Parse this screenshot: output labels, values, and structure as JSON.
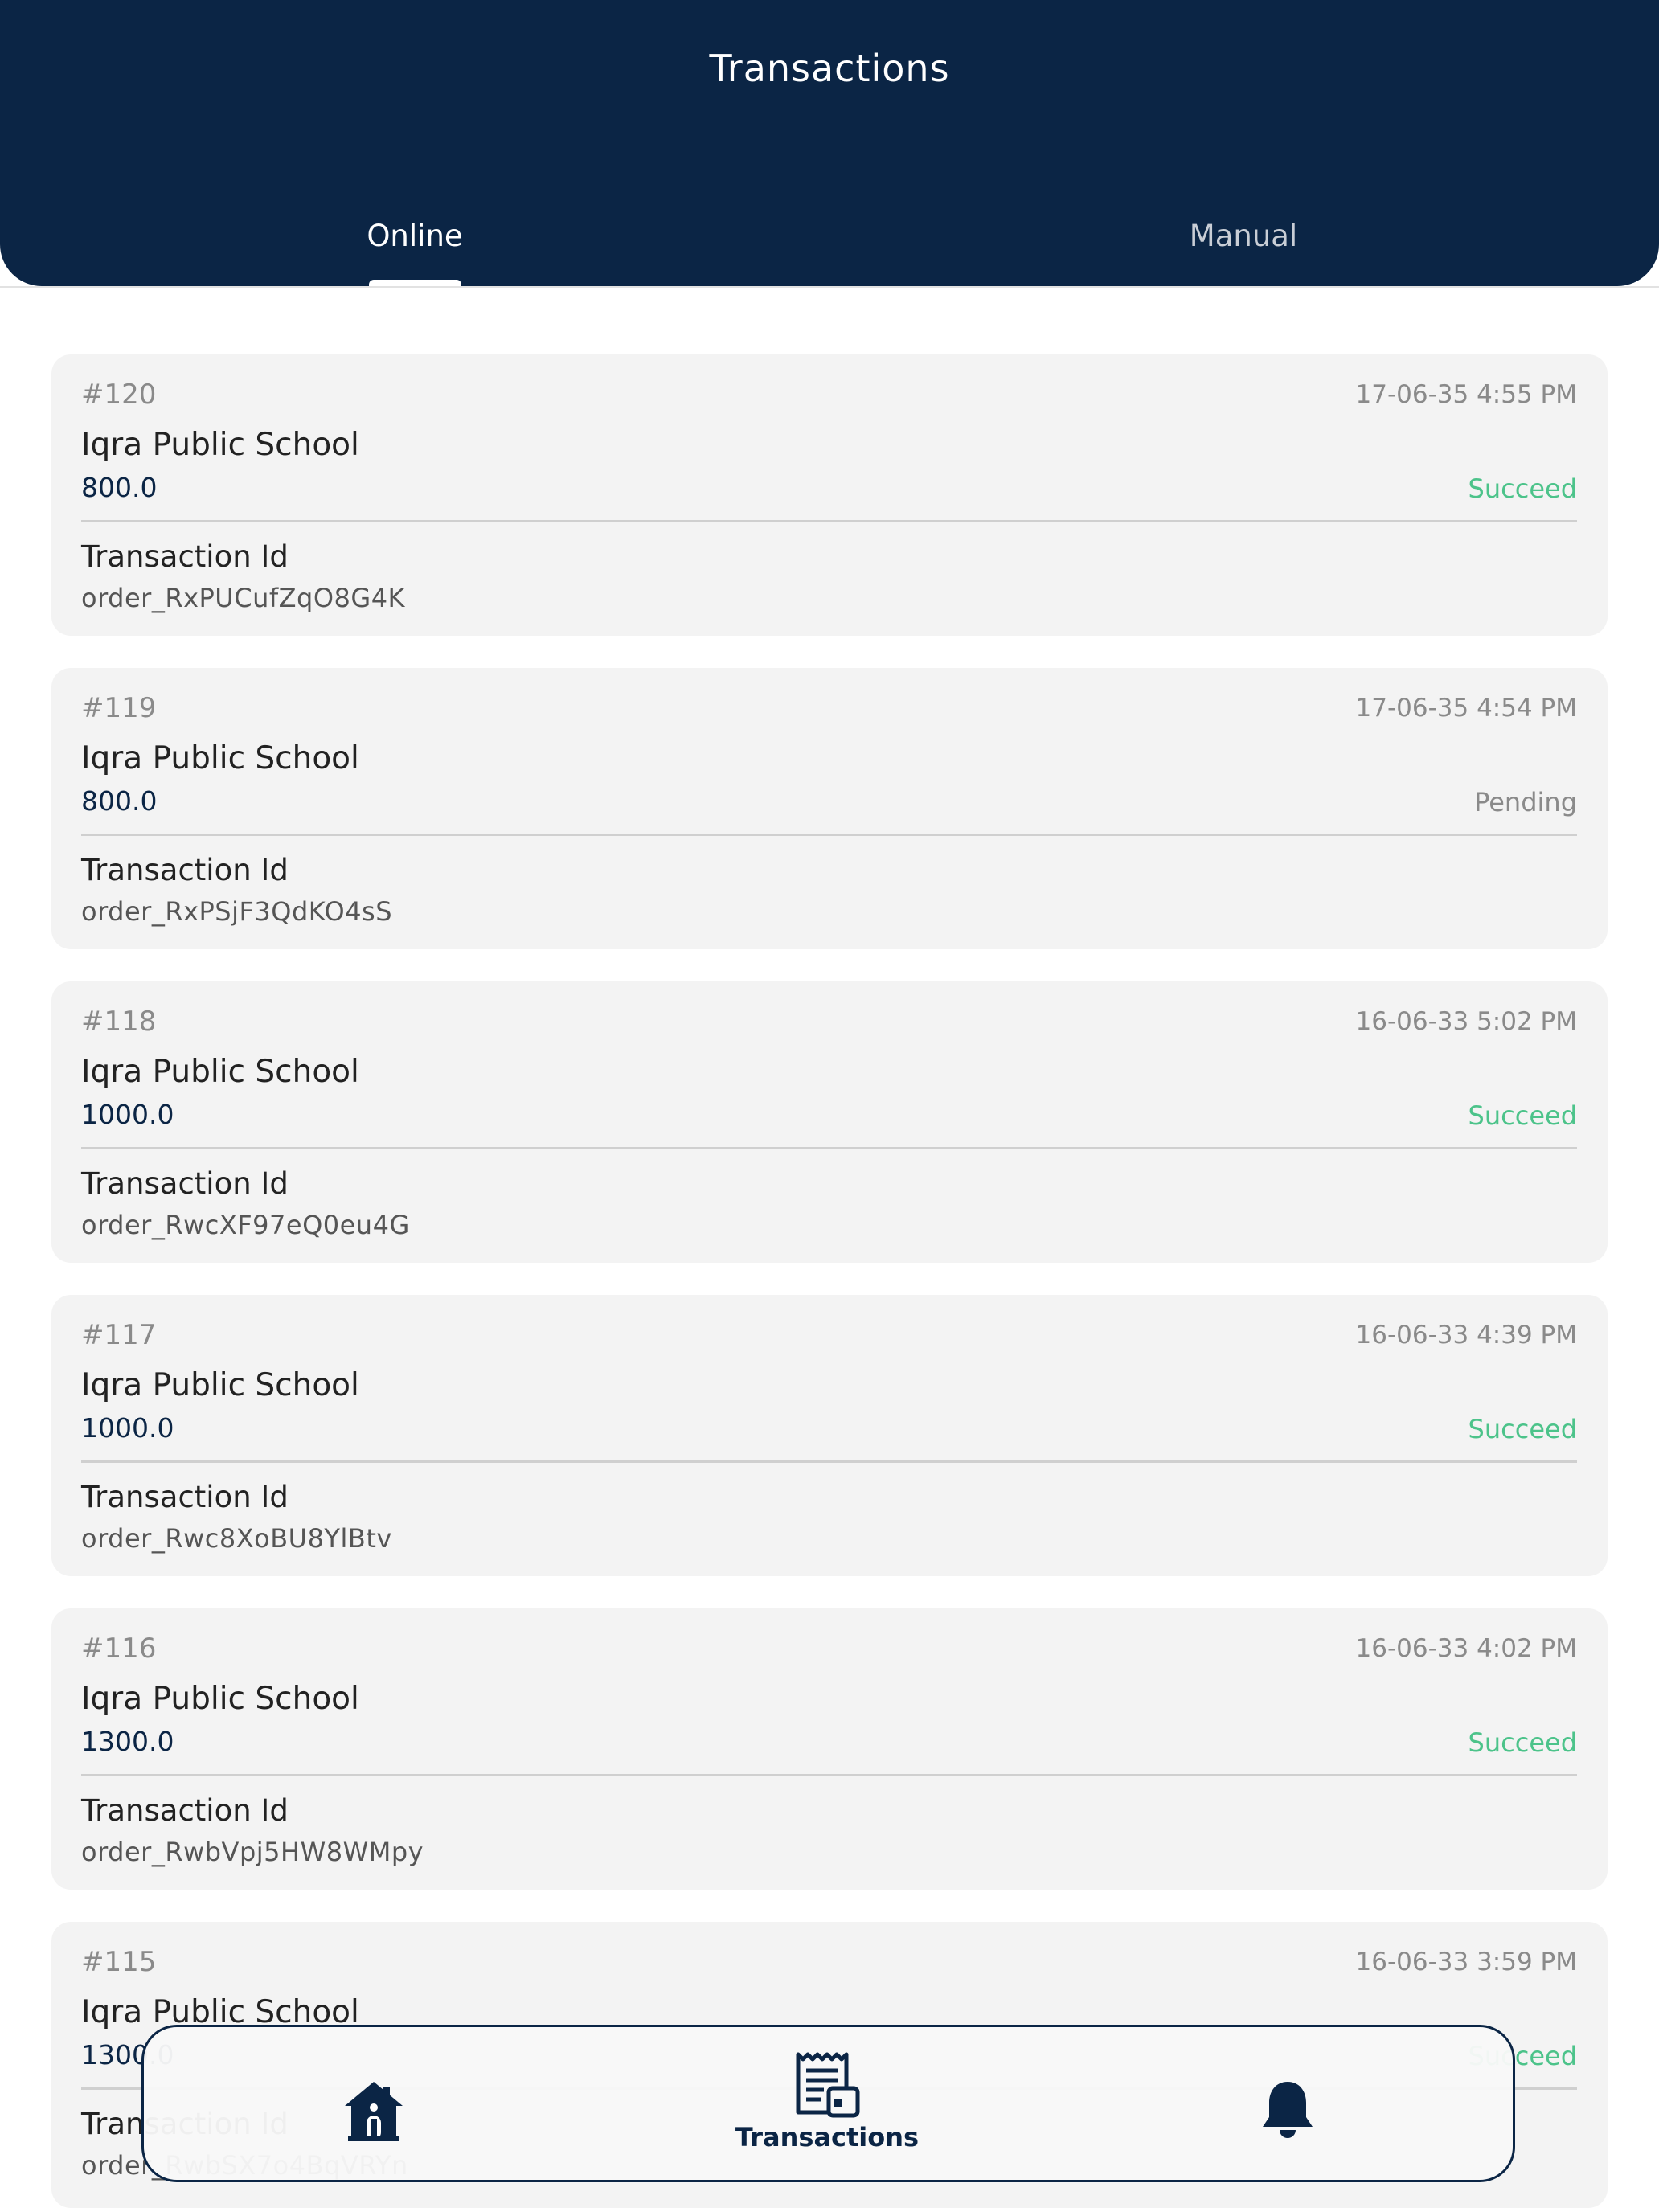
{
  "header": {
    "title": "Transactions"
  },
  "tabs": [
    {
      "label": "Online",
      "active": true
    },
    {
      "label": "Manual",
      "active": false
    }
  ],
  "transactions": [
    {
      "number": "#120",
      "datetime": "17-06-35  4:55 PM",
      "school": "Iqra Public School",
      "amount": "800.0",
      "status": "Succeed",
      "transaction_id_label": "Transaction Id",
      "transaction_id": "order_RxPUCufZqO8G4K"
    },
    {
      "number": "#119",
      "datetime": "17-06-35  4:54 PM",
      "school": "Iqra Public School",
      "amount": "800.0",
      "status": "Pending",
      "transaction_id_label": "Transaction Id",
      "transaction_id": "order_RxPSjF3QdKO4sS"
    },
    {
      "number": "#118",
      "datetime": "16-06-33  5:02 PM",
      "school": "Iqra Public School",
      "amount": "1000.0",
      "status": "Succeed",
      "transaction_id_label": "Transaction Id",
      "transaction_id": "order_RwcXF97eQ0eu4G"
    },
    {
      "number": "#117",
      "datetime": "16-06-33  4:39 PM",
      "school": "Iqra Public School",
      "amount": "1000.0",
      "status": "Succeed",
      "transaction_id_label": "Transaction Id",
      "transaction_id": "order_Rwc8XoBU8YlBtv"
    },
    {
      "number": "#116",
      "datetime": "16-06-33  4:02 PM",
      "school": "Iqra Public School",
      "amount": "1300.0",
      "status": "Succeed",
      "transaction_id_label": "Transaction Id",
      "transaction_id": "order_RwbVpj5HW8WMpy"
    },
    {
      "number": "#115",
      "datetime": "16-06-33  3:59 PM",
      "school": "Iqra Public School",
      "amount": "1300.0",
      "status": "Succeed",
      "transaction_id_label": "Transaction Id",
      "transaction_id": "order_RwbSX7o4BqVRYn"
    }
  ],
  "bottom_nav": {
    "items": [
      {
        "icon": "home-icon",
        "label": ""
      },
      {
        "icon": "receipt-icon",
        "label": "Transactions",
        "active": true
      },
      {
        "icon": "bell-icon",
        "label": ""
      }
    ]
  },
  "colors": {
    "primary": "#0b2545",
    "success": "#4cc38a",
    "muted": "#8a8a8a",
    "card": "#f3f3f3"
  }
}
